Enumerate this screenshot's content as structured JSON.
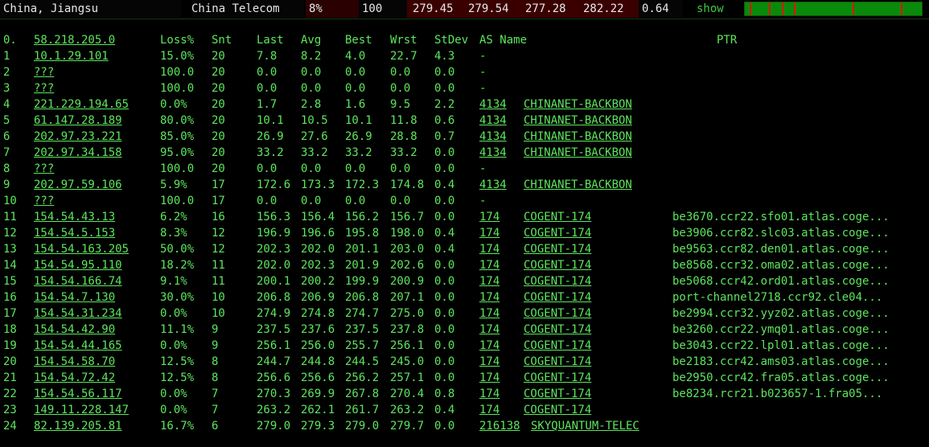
{
  "header": {
    "location": "China, Jiangsu",
    "isp": "China Telecom",
    "loss": "8%",
    "snt": "100",
    "last": "279.45",
    "avg": "279.54",
    "best": "277.28",
    "wrst": "282.22",
    "stdev": "0.64",
    "show_label": "show"
  },
  "columns": {
    "hop": "0.",
    "host": "58.218.205.0",
    "loss": "Loss%",
    "snt": "Snt",
    "last": "Last",
    "avg": "Avg",
    "best": "Best",
    "wrst": "Wrst",
    "stdev": "StDev",
    "as": "AS Name",
    "ptr": "PTR"
  },
  "rows": [
    {
      "hop": "1",
      "host": "10.1.29.101",
      "loss": "15.0%",
      "snt": "20",
      "last": "7.8",
      "avg": "8.2",
      "best": "4.0",
      "wrst": "22.7",
      "stdev": "4.3",
      "asn": "-",
      "asname": "",
      "ptr": ""
    },
    {
      "hop": "2",
      "host": "???",
      "loss": "100.0",
      "snt": "20",
      "last": "0.0",
      "avg": "0.0",
      "best": "0.0",
      "wrst": "0.0",
      "stdev": "0.0",
      "asn": "-",
      "asname": "",
      "ptr": ""
    },
    {
      "hop": "3",
      "host": "???",
      "loss": "100.0",
      "snt": "20",
      "last": "0.0",
      "avg": "0.0",
      "best": "0.0",
      "wrst": "0.0",
      "stdev": "0.0",
      "asn": "-",
      "asname": "",
      "ptr": ""
    },
    {
      "hop": "4",
      "host": "221.229.194.65",
      "loss": "0.0%",
      "snt": "20",
      "last": "1.7",
      "avg": "2.8",
      "best": "1.6",
      "wrst": "9.5",
      "stdev": "2.2",
      "asn": "4134",
      "asname": "CHINANET-BACKBON",
      "ptr": ""
    },
    {
      "hop": "5",
      "host": "61.147.28.189",
      "loss": "80.0%",
      "snt": "20",
      "last": "10.1",
      "avg": "10.5",
      "best": "10.1",
      "wrst": "11.8",
      "stdev": "0.6",
      "asn": "4134",
      "asname": "CHINANET-BACKBON",
      "ptr": ""
    },
    {
      "hop": "6",
      "host": "202.97.23.221",
      "loss": "85.0%",
      "snt": "20",
      "last": "26.9",
      "avg": "27.6",
      "best": "26.9",
      "wrst": "28.8",
      "stdev": "0.7",
      "asn": "4134",
      "asname": "CHINANET-BACKBON",
      "ptr": ""
    },
    {
      "hop": "7",
      "host": "202.97.34.158",
      "loss": "95.0%",
      "snt": "20",
      "last": "33.2",
      "avg": "33.2",
      "best": "33.2",
      "wrst": "33.2",
      "stdev": "0.0",
      "asn": "4134",
      "asname": "CHINANET-BACKBON",
      "ptr": ""
    },
    {
      "hop": "8",
      "host": "???",
      "loss": "100.0",
      "snt": "20",
      "last": "0.0",
      "avg": "0.0",
      "best": "0.0",
      "wrst": "0.0",
      "stdev": "0.0",
      "asn": "-",
      "asname": "",
      "ptr": ""
    },
    {
      "hop": "9",
      "host": "202.97.59.106",
      "loss": "5.9%",
      "snt": "17",
      "last": "172.6",
      "avg": "173.3",
      "best": "172.3",
      "wrst": "174.8",
      "stdev": "0.4",
      "asn": "4134",
      "asname": "CHINANET-BACKBON",
      "ptr": ""
    },
    {
      "hop": "10",
      "host": "???",
      "loss": "100.0",
      "snt": "17",
      "last": "0.0",
      "avg": "0.0",
      "best": "0.0",
      "wrst": "0.0",
      "stdev": "0.0",
      "asn": "-",
      "asname": "",
      "ptr": ""
    },
    {
      "hop": "11",
      "host": "154.54.43.13",
      "loss": "6.2%",
      "snt": "16",
      "last": "156.3",
      "avg": "156.4",
      "best": "156.2",
      "wrst": "156.7",
      "stdev": "0.0",
      "asn": "174",
      "asname": "COGENT-174",
      "ptr": "be3670.ccr22.sfo01.atlas.coge..."
    },
    {
      "hop": "12",
      "host": "154.54.5.153",
      "loss": "8.3%",
      "snt": "12",
      "last": "196.9",
      "avg": "196.6",
      "best": "195.8",
      "wrst": "198.0",
      "stdev": "0.4",
      "asn": "174",
      "asname": "COGENT-174",
      "ptr": "be3906.ccr82.slc03.atlas.coge..."
    },
    {
      "hop": "13",
      "host": "154.54.163.205",
      "loss": "50.0%",
      "snt": "12",
      "last": "202.3",
      "avg": "202.0",
      "best": "201.1",
      "wrst": "203.0",
      "stdev": "0.4",
      "asn": "174",
      "asname": "COGENT-174",
      "ptr": "be9563.ccr82.den01.atlas.coge..."
    },
    {
      "hop": "14",
      "host": "154.54.95.110",
      "loss": "18.2%",
      "snt": "11",
      "last": "202.0",
      "avg": "202.3",
      "best": "201.9",
      "wrst": "202.6",
      "stdev": "0.0",
      "asn": "174",
      "asname": "COGENT-174",
      "ptr": "be8568.ccr32.oma02.atlas.coge..."
    },
    {
      "hop": "15",
      "host": "154.54.166.74",
      "loss": "9.1%",
      "snt": "11",
      "last": "200.1",
      "avg": "200.2",
      "best": "199.9",
      "wrst": "200.9",
      "stdev": "0.0",
      "asn": "174",
      "asname": "COGENT-174",
      "ptr": "be5068.ccr42.ord01.atlas.coge..."
    },
    {
      "hop": "16",
      "host": "154.54.7.130",
      "loss": "30.0%",
      "snt": "10",
      "last": "206.8",
      "avg": "206.9",
      "best": "206.8",
      "wrst": "207.1",
      "stdev": "0.0",
      "asn": "174",
      "asname": "COGENT-174",
      "ptr": "port-channel2718.ccr92.cle04..."
    },
    {
      "hop": "17",
      "host": "154.54.31.234",
      "loss": "0.0%",
      "snt": "10",
      "last": "274.9",
      "avg": "274.8",
      "best": "274.7",
      "wrst": "275.0",
      "stdev": "0.0",
      "asn": "174",
      "asname": "COGENT-174",
      "ptr": "be2994.ccr32.yyz02.atlas.coge..."
    },
    {
      "hop": "18",
      "host": "154.54.42.90",
      "loss": "11.1%",
      "snt": "9",
      "last": "237.5",
      "avg": "237.6",
      "best": "237.5",
      "wrst": "237.8",
      "stdev": "0.0",
      "asn": "174",
      "asname": "COGENT-174",
      "ptr": "be3260.ccr22.ymq01.atlas.coge..."
    },
    {
      "hop": "19",
      "host": "154.54.44.165",
      "loss": "0.0%",
      "snt": "9",
      "last": "256.1",
      "avg": "256.0",
      "best": "255.7",
      "wrst": "256.1",
      "stdev": "0.0",
      "asn": "174",
      "asname": "COGENT-174",
      "ptr": "be3043.ccr22.lpl01.atlas.coge..."
    },
    {
      "hop": "20",
      "host": "154.54.58.70",
      "loss": "12.5%",
      "snt": "8",
      "last": "244.7",
      "avg": "244.8",
      "best": "244.5",
      "wrst": "245.0",
      "stdev": "0.0",
      "asn": "174",
      "asname": "COGENT-174",
      "ptr": "be2183.ccr42.ams03.atlas.coge..."
    },
    {
      "hop": "21",
      "host": "154.54.72.42",
      "loss": "12.5%",
      "snt": "8",
      "last": "256.6",
      "avg": "256.6",
      "best": "256.2",
      "wrst": "257.1",
      "stdev": "0.0",
      "asn": "174",
      "asname": "COGENT-174",
      "ptr": "be2950.ccr42.fra05.atlas.coge..."
    },
    {
      "hop": "22",
      "host": "154.54.56.117",
      "loss": "0.0%",
      "snt": "7",
      "last": "270.3",
      "avg": "269.9",
      "best": "267.8",
      "wrst": "270.4",
      "stdev": "0.8",
      "asn": "174",
      "asname": "COGENT-174",
      "ptr": "be8234.rcr21.b023657-1.fra05..."
    },
    {
      "hop": "23",
      "host": "149.11.228.147",
      "loss": "0.0%",
      "snt": "7",
      "last": "263.2",
      "avg": "262.1",
      "best": "261.7",
      "wrst": "263.2",
      "stdev": "0.4",
      "asn": "174",
      "asname": "COGENT-174",
      "ptr": ""
    },
    {
      "hop": "24",
      "host": "82.139.205.81",
      "loss": "16.7%",
      "snt": "6",
      "last": "279.0",
      "avg": "279.3",
      "best": "279.0",
      "wrst": "279.7",
      "stdev": "0.0",
      "asn": "216138",
      "asname": "SKYQUANTUM-TELEC",
      "ptr": ""
    }
  ]
}
